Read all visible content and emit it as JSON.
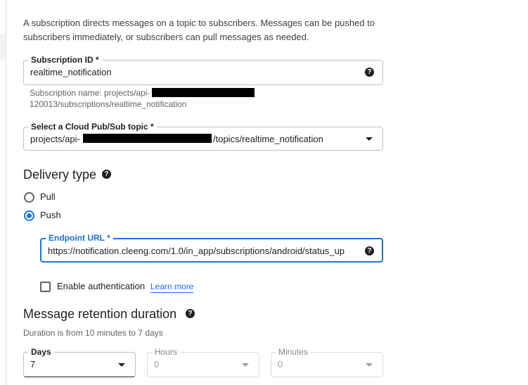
{
  "intro": {
    "line1": "A subscription directs messages on a topic to subscribers. Messages can be pushed to",
    "line2": "subscribers immediately, or subscribers can pull messages as needed."
  },
  "subscription_id": {
    "label": "Subscription ID *",
    "value": "realtime_notification",
    "hint_line1": "Subscription name: projects/api-",
    "hint_line2": "120013/subscriptions/realtime_notification"
  },
  "topic": {
    "label": "Select a Cloud Pub/Sub topic *",
    "value_prefix": "projects/api-",
    "value_suffix": "/topics/realtime_notification"
  },
  "delivery": {
    "title": "Delivery type",
    "options": [
      {
        "label": "Pull",
        "selected": false
      },
      {
        "label": "Push",
        "selected": true
      }
    ],
    "endpoint": {
      "label": "Endpoint URL *",
      "value": "https://notification.cleeng.com/1.0/in_app/subscriptions/android/status_up"
    },
    "auth_label": "Enable authentication",
    "learn_more": "Learn more"
  },
  "retention": {
    "title": "Message retention duration",
    "hint": "Duration is from 10 minutes to 7 days",
    "days": {
      "label": "Days",
      "value": "7"
    },
    "hours": {
      "label": "Hours",
      "value": "0"
    },
    "minutes": {
      "label": "Minutes",
      "value": "0"
    }
  },
  "colors": {
    "accent": "#1a73e8",
    "text": "#202124",
    "muted": "#9aa0a6"
  }
}
